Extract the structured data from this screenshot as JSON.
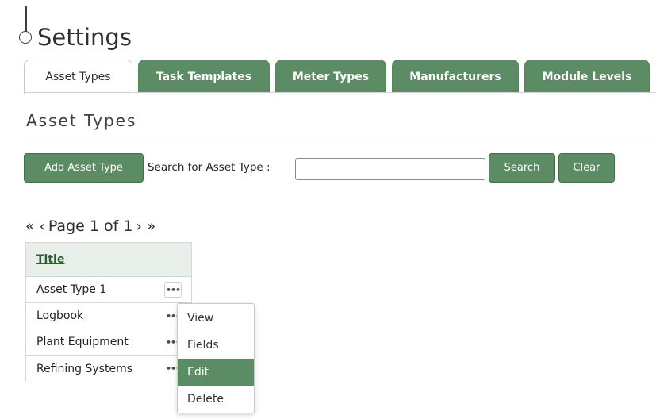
{
  "page": {
    "title": "Settings"
  },
  "tabs": [
    {
      "label": "Asset Types",
      "active": true
    },
    {
      "label": "Task Templates",
      "active": false
    },
    {
      "label": "Meter Types",
      "active": false
    },
    {
      "label": "Manufacturers",
      "active": false
    },
    {
      "label": "Module Levels",
      "active": false
    }
  ],
  "section": {
    "heading": "Asset Types"
  },
  "toolbar": {
    "add_label": "Add Asset Type",
    "search_label": "Search for Asset Type :",
    "search_value": "",
    "search_button": "Search",
    "clear_button": "Clear"
  },
  "pager": {
    "first": "«",
    "prev": "‹",
    "text": "Page 1 of 1",
    "next": "›",
    "last": "»"
  },
  "table": {
    "header": "Title",
    "rows": [
      {
        "title": "Asset Type 1",
        "actions": "•••"
      },
      {
        "title": "Logbook",
        "actions": "•••"
      },
      {
        "title": "Plant Equipment",
        "actions": "•••"
      },
      {
        "title": "Refining Systems",
        "actions": "•••"
      }
    ]
  },
  "context_menu": {
    "items": [
      "View",
      "Fields",
      "Edit",
      "Delete"
    ],
    "highlighted": "Edit"
  },
  "colors": {
    "accent": "#5c8c63",
    "header_bg": "#e8efe8",
    "link": "#2e5f34"
  }
}
